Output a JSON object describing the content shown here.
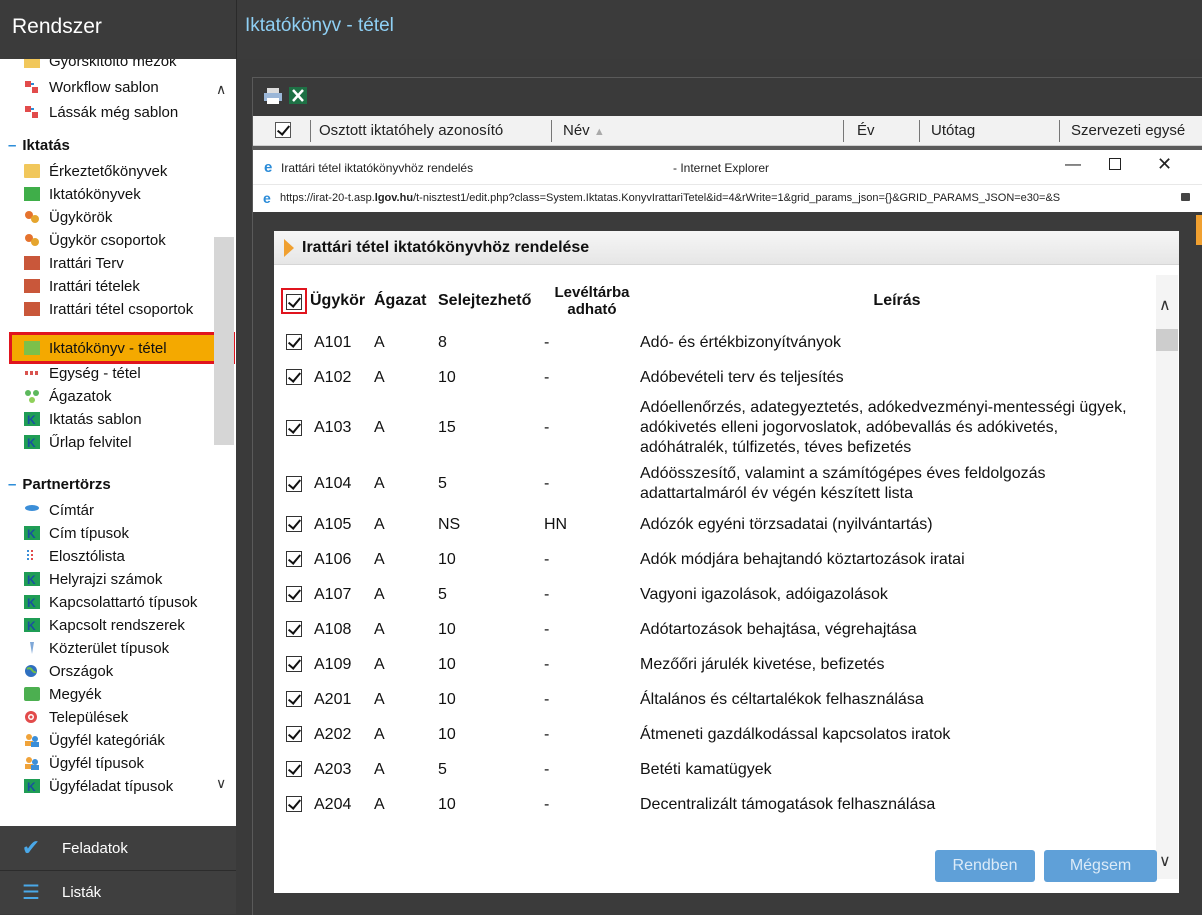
{
  "topbar": {
    "system": "Rendszer",
    "title": "Iktatókönyv - tétel"
  },
  "sidebar": {
    "partial_item": "Gyorskitöltő mezők",
    "items_top": [
      {
        "label": "Workflow sablon",
        "icon": "workflow-icon"
      },
      {
        "label": "Lássák még sablon",
        "icon": "workflow-icon"
      }
    ],
    "section_iktatas": "Iktatás",
    "iktatas_items": [
      {
        "label": "Érkeztetőkönyvek",
        "icon": "book-icon"
      },
      {
        "label": "Iktatókönyvek",
        "icon": "check-book-icon"
      },
      {
        "label": "Ügykörök",
        "icon": "circles-icon"
      },
      {
        "label": "Ügykör csoportok",
        "icon": "circles-icon"
      },
      {
        "label": "Irattári Terv",
        "icon": "archive-icon"
      },
      {
        "label": "Irattári tételek",
        "icon": "archive-icon"
      },
      {
        "label": "Irattári tétel csoportok",
        "icon": "archive-icon"
      },
      {
        "label": "Iktatókönyv - tétel",
        "icon": "book-icon"
      },
      {
        "label": "Egység - tétel",
        "icon": "unit-icon"
      },
      {
        "label": "Ágazatok",
        "icon": "dots-icon"
      },
      {
        "label": "Iktatás sablon",
        "icon": "k-icon"
      },
      {
        "label": "Űrlap felvitel",
        "icon": "k-icon"
      }
    ],
    "section_partner": "Partnertörzs",
    "partner_items": [
      {
        "label": "Címtár",
        "icon": "directory-icon"
      },
      {
        "label": "Cím típusok",
        "icon": "k-icon"
      },
      {
        "label": "Elosztólista",
        "icon": "list-icon"
      },
      {
        "label": "Helyrajzi számok",
        "icon": "k-icon"
      },
      {
        "label": "Kapcsolattartó típusok",
        "icon": "k-icon"
      },
      {
        "label": "Kapcsolt rendszerek",
        "icon": "k-icon"
      },
      {
        "label": "Közterület típusok",
        "icon": "road-icon"
      },
      {
        "label": "Országok",
        "icon": "globe-icon"
      },
      {
        "label": "Megyék",
        "icon": "map-icon"
      },
      {
        "label": "Települések",
        "icon": "target-icon"
      },
      {
        "label": "Ügyfél kategóriák",
        "icon": "users-icon"
      },
      {
        "label": "Ügyfél típusok",
        "icon": "users-icon"
      },
      {
        "label": "Ügyféladat típusok",
        "icon": "k-icon"
      }
    ]
  },
  "bottom_nav": {
    "tasks": "Feladatok",
    "lists": "Listák"
  },
  "grid": {
    "columns": [
      "Osztott iktatóhely azonosító",
      "Név",
      "Év",
      "Utótag",
      "Szervezeti egysé"
    ]
  },
  "popup": {
    "window_title": "Irattári tétel iktatókönyvhöz rendelés",
    "browser_name": "- Internet Explorer",
    "url_prefix": "https://irat-20-t.asp.",
    "url_domain": "lgov.hu",
    "url_rest": "/t-nisztest1/edit.php?class=System.Iktatas.KonyvIrattariTetel&id=4&rWrite=1&grid_params_json={}&GRID_PARAMS_JSON=e30=&S",
    "dialog_title": "Irattári tétel iktatókönyvhöz rendelése",
    "headers": {
      "ugykor": "Ügykör",
      "agazat": "Ágazat",
      "selejt": "Selejtezhető",
      "leveltar": "Levéltárba adható",
      "leiras": "Leírás"
    },
    "rows": [
      {
        "ugykor": "A101",
        "agazat": "A",
        "selejt": "8",
        "leveltar": "-",
        "leiras": "Adó- és értékbizonyítványok"
      },
      {
        "ugykor": "A102",
        "agazat": "A",
        "selejt": "10",
        "leveltar": "-",
        "leiras": "Adóbevételi terv és teljesítés"
      },
      {
        "ugykor": "A103",
        "agazat": "A",
        "selejt": "15",
        "leveltar": "-",
        "leiras": "Adóellenőrzés, adategyeztetés, adókedvezményi-mentességi ügyek, adókivetés elleni jogorvoslatok, adóbevallás és adókivetés, adóhátralék, túlfizetés, téves befizetés"
      },
      {
        "ugykor": "A104",
        "agazat": "A",
        "selejt": "5",
        "leveltar": "-",
        "leiras": "Adóösszesítő, valamint a számítógépes éves feldolgozás adattartalmáról év végén készített lista"
      },
      {
        "ugykor": "A105",
        "agazat": "A",
        "selejt": "NS",
        "leveltar": "HN",
        "leiras": "Adózók egyéni törzsadatai (nyilvántartás)"
      },
      {
        "ugykor": "A106",
        "agazat": "A",
        "selejt": "10",
        "leveltar": "-",
        "leiras": "Adók módjára behajtandó köztartozások iratai"
      },
      {
        "ugykor": "A107",
        "agazat": "A",
        "selejt": "5",
        "leveltar": "-",
        "leiras": "Vagyoni igazolások, adóigazolások"
      },
      {
        "ugykor": "A108",
        "agazat": "A",
        "selejt": "10",
        "leveltar": "-",
        "leiras": "Adótartozások behajtása, végrehajtása"
      },
      {
        "ugykor": "A109",
        "agazat": "A",
        "selejt": "10",
        "leveltar": "-",
        "leiras": "Mezőőri járulék kivetése, befizetés"
      },
      {
        "ugykor": "A201",
        "agazat": "A",
        "selejt": "10",
        "leveltar": "-",
        "leiras": "Általános és céltartalékok felhasználása"
      },
      {
        "ugykor": "A202",
        "agazat": "A",
        "selejt": "10",
        "leveltar": "-",
        "leiras": "Átmeneti gazdálkodással kapcsolatos iratok"
      },
      {
        "ugykor": "A203",
        "agazat": "A",
        "selejt": "5",
        "leveltar": "-",
        "leiras": "Betéti kamatügyek"
      },
      {
        "ugykor": "A204",
        "agazat": "A",
        "selejt": "10",
        "leveltar": "-",
        "leiras": "Decentralizált támogatások felhasználása"
      }
    ],
    "ok_label": "Rendben",
    "cancel_label": "Mégsem"
  },
  "colors": {
    "highlight": "#f4a900",
    "red_outline": "#e0141e",
    "title_blue": "#8fd0f5",
    "button": "#5fa0d8"
  }
}
